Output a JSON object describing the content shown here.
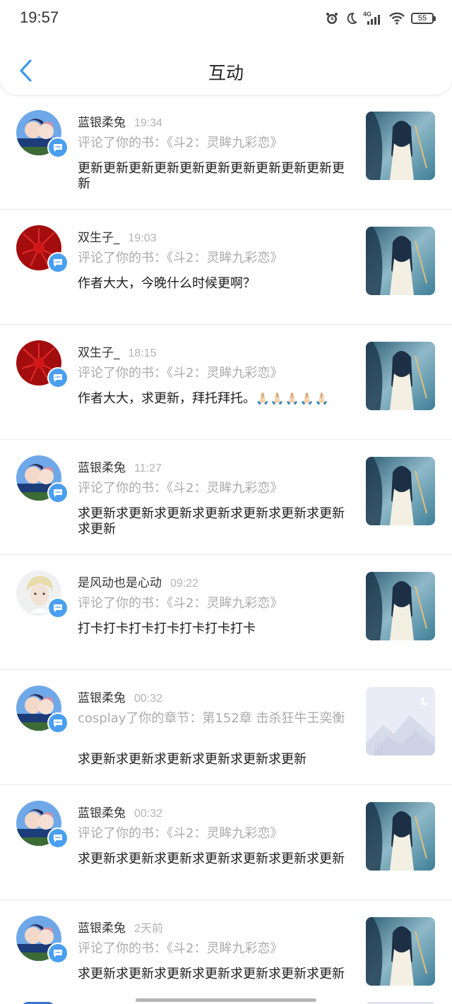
{
  "status_bar": {
    "time": "19:57",
    "battery": "55",
    "network": "4G"
  },
  "header": {
    "title": "互动"
  },
  "items": [
    {
      "name": "蓝银柔兔",
      "time": "19:34",
      "context": "评论了你的书：《斗2：灵眸九彩恋》",
      "message": "更新更新更新更新更新更新更新更新更新更新更新",
      "avatar": "couple-photo",
      "thumb": "book-cover"
    },
    {
      "name": "双生子_",
      "time": "19:03",
      "context": "评论了你的书：《斗2：灵眸九彩恋》",
      "message": "作者大大，今晚什么时候更啊？",
      "avatar": "red-flower",
      "thumb": "book-cover"
    },
    {
      "name": "双生子_",
      "time": "18:15",
      "context": "评论了你的书：《斗2：灵眸九彩恋》",
      "message": "作者大大，求更新，拜托拜托。",
      "emoji": "🙏🏻🙏🏻🙏🏻🙏🏻🙏🏻",
      "avatar": "red-flower",
      "thumb": "book-cover"
    },
    {
      "name": "蓝银柔兔",
      "time": "11:27",
      "context": "评论了你的书：《斗2：灵眸九彩恋》",
      "message": "求更新求更新求更新求更新求更新求更新求更新求更新",
      "avatar": "couple-photo",
      "thumb": "book-cover"
    },
    {
      "name": "是风动也是心动",
      "time": "09:22",
      "context": "评论了你的书：《斗2：灵眸九彩恋》",
      "message": "打卡打卡打卡打卡打卡打卡打卡",
      "avatar": "blond-portrait",
      "thumb": "book-cover"
    },
    {
      "name": "蓝银柔兔",
      "time": "00:32",
      "context": "cosplay了你的章节：第152章 击杀狂牛王奕衡",
      "message": "求更新求更新求更新求更新求更新求更新",
      "avatar": "couple-photo",
      "thumb": "placeholder-image"
    },
    {
      "name": "蓝银柔兔",
      "time": "00:32",
      "context": "评论了你的书：《斗2：灵眸九彩恋》",
      "message": "求更新求更新求更新求更新求更新求更新求更新",
      "avatar": "couple-photo",
      "thumb": "book-cover"
    },
    {
      "name": "蓝银柔兔",
      "time": "2天前",
      "context": "评论了你的书：《斗2：灵眸九彩恋》",
      "message": "求更新求更新求更新求更新求更新求更新求更新",
      "avatar": "couple-photo",
      "thumb": "book-cover"
    }
  ],
  "colors": {
    "accent": "#3f98e8",
    "badge": "#4a9ff0",
    "muted_text": "#ababab",
    "divider": "#ececec"
  }
}
